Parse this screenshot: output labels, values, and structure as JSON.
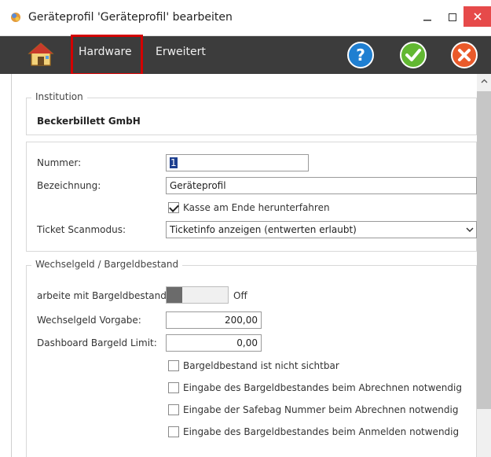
{
  "window": {
    "title": "Geräteprofil 'Geräteprofil' bearbeiten"
  },
  "toolbar": {
    "tabs": [
      {
        "label": "Hardware",
        "active": true
      },
      {
        "label": "Erweitert",
        "active": false
      }
    ]
  },
  "institution": {
    "legend": "Institution",
    "name": "Beckerbillett GmbH"
  },
  "general": {
    "nummer_label": "Nummer:",
    "nummer_value": "1",
    "bezeichnung_label": "Bezeichnung:",
    "bezeichnung_value": "Geräteprofil",
    "kasse_label": "Kasse am Ende herunterfahren",
    "kasse_checked": true,
    "scanmodus_label": "Ticket Scanmodus:",
    "scanmodus_value": "Ticketinfo anzeigen (entwerten erlaubt)"
  },
  "cash": {
    "legend": "Wechselgeld / Bargeldbestand",
    "arbeite_label": "arbeite mit Bargeldbestand:",
    "arbeite_state": "Off",
    "vorgabe_label": "Wechselgeld Vorgabe:",
    "vorgabe_value": "200,00",
    "limit_label": "Dashboard Bargeld Limit:",
    "limit_value": "0,00",
    "checkboxes": [
      {
        "label": "Bargeldbestand ist nicht sichtbar",
        "checked": false
      },
      {
        "label": "Eingabe des Bargeldbestandes beim Abrechnen notwendig",
        "checked": false
      },
      {
        "label": "Eingabe der Safebag Nummer beim Abrechnen notwendig",
        "checked": false
      },
      {
        "label": "Eingabe des Bargeldbestandes beim Anmelden notwendig",
        "checked": false
      }
    ]
  },
  "colors": {
    "toolbar_bg": "#3c3c3c",
    "close_button": "#e64a4a",
    "highlight_border": "#d40000",
    "help_icon": "#1f7fd1",
    "ok_icon": "#62b832",
    "cancel_icon": "#ea5a2a"
  },
  "icons": {
    "app": "app-gear-icon",
    "home": "home-icon",
    "help": "help-icon",
    "ok": "check-icon",
    "cancel": "close-icon"
  }
}
